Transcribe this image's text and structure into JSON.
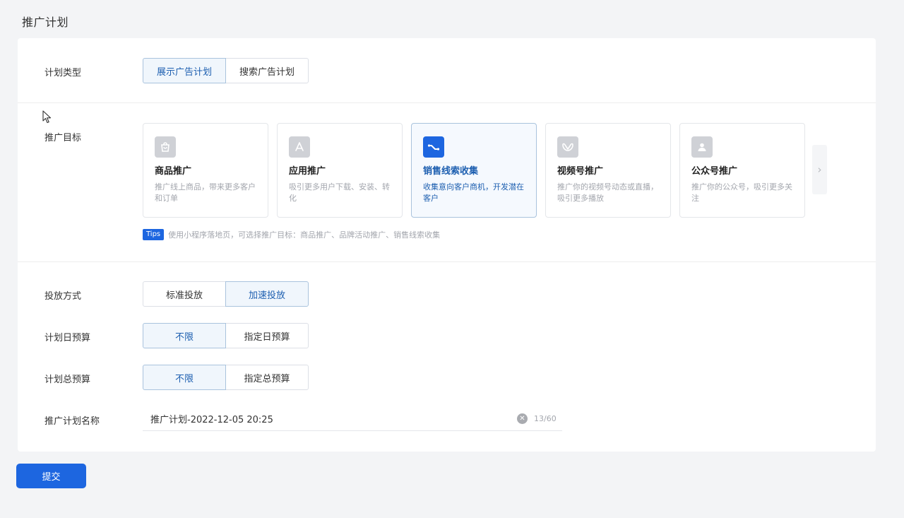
{
  "page": {
    "title": "推广计划"
  },
  "plan_type": {
    "label": "计划类型",
    "options": [
      "展示广告计划",
      "搜索广告计划"
    ],
    "selected": "展示广告计划"
  },
  "goal": {
    "label": "推广目标",
    "items": [
      {
        "icon": "shopping-bag-icon",
        "title": "商品推广",
        "desc": "推广线上商品，带来更多客户和订单"
      },
      {
        "icon": "app-store-icon",
        "title": "应用推广",
        "desc": "吸引更多用户下载、安装、转化"
      },
      {
        "icon": "trend-icon",
        "title": "销售线索收集",
        "desc": "收集意向客户商机，开发潜在客户"
      },
      {
        "icon": "butterfly-icon",
        "title": "视频号推广",
        "desc": "推广你的视频号动态或直播，吸引更多播放"
      },
      {
        "icon": "person-icon",
        "title": "公众号推广",
        "desc": "推广你的公众号，吸引更多关注"
      }
    ],
    "selected_index": 2,
    "tips_badge": "Tips",
    "tips_text": "使用小程序落地页，可选择推广目标：商品推广、品牌活动推广、销售线索收集"
  },
  "delivery": {
    "label": "投放方式",
    "options": [
      "标准投放",
      "加速投放"
    ],
    "selected": "加速投放"
  },
  "daily_budget": {
    "label": "计划日预算",
    "options": [
      "不限",
      "指定日预算"
    ],
    "selected": "不限"
  },
  "total_budget": {
    "label": "计划总预算",
    "options": [
      "不限",
      "指定总预算"
    ],
    "selected": "不限"
  },
  "plan_name": {
    "label": "推广计划名称",
    "value": "推广计划-2022-12-05 20:25",
    "count": "13/60"
  },
  "submit_label": "提交",
  "colors": {
    "accent": "#1d66e0",
    "selected_text": "#1d5fb0",
    "selected_border": "#a9c3dd"
  }
}
